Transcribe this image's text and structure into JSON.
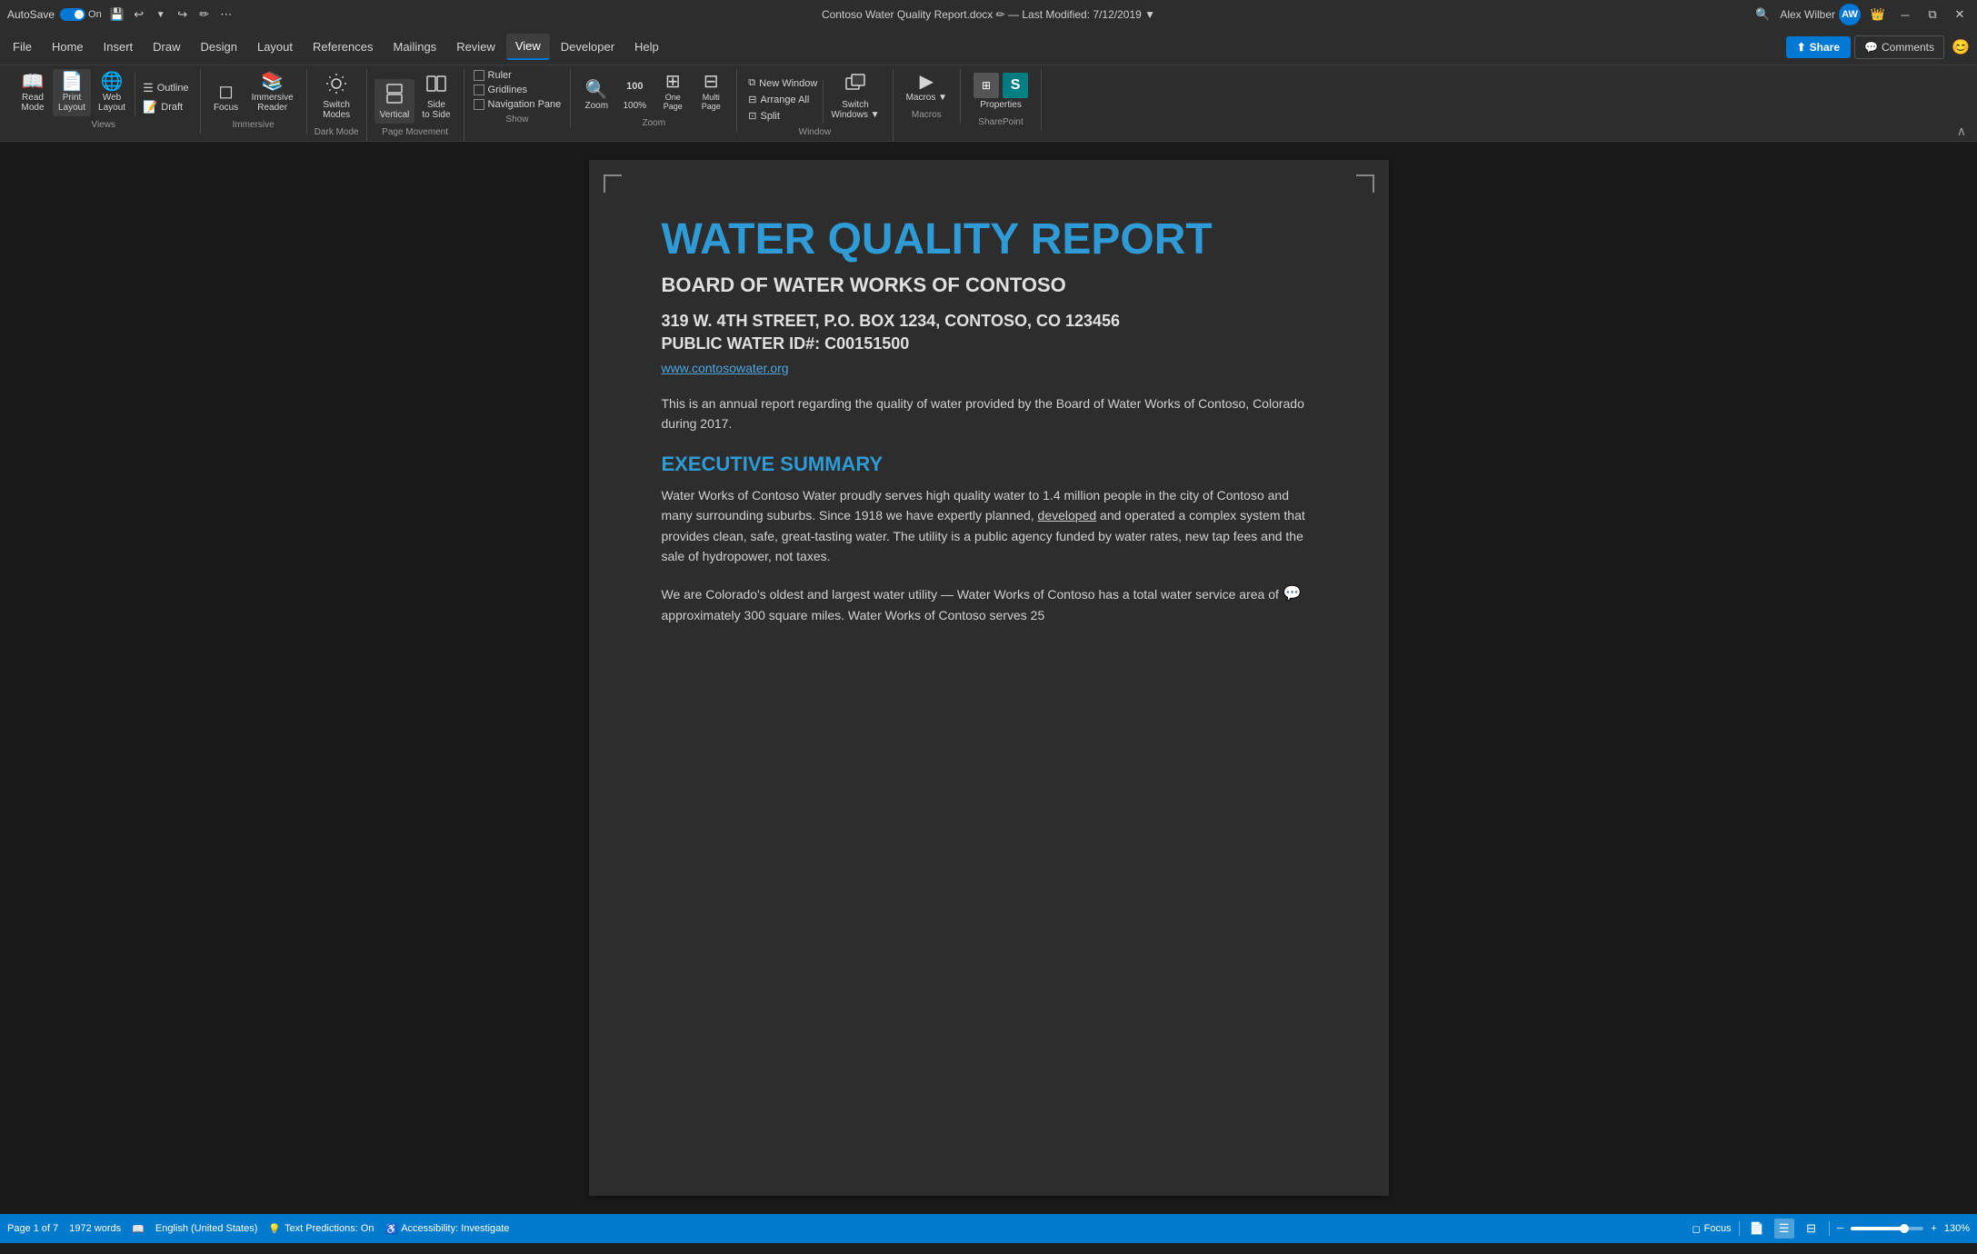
{
  "titlebar": {
    "autosave": "AutoSave",
    "on_label": "On",
    "filename": "Contoso Water Quality Report.docx",
    "separator": "—",
    "last_modified": "Last Modified: 7/12/2019",
    "user_name": "Alex Wilber",
    "user_initials": "AW"
  },
  "toolbar_icons": {
    "undo": "↩",
    "redo": "↪",
    "save": "💾",
    "more": "⋯"
  },
  "menu": {
    "items": [
      "File",
      "Home",
      "Insert",
      "Draw",
      "Design",
      "Layout",
      "References",
      "Mailings",
      "Review",
      "View",
      "Developer",
      "Help"
    ],
    "active": "View",
    "share_label": "Share",
    "comments_label": "Comments"
  },
  "ribbon": {
    "views_group": {
      "label": "Views",
      "buttons": [
        {
          "id": "read-mode",
          "icon": "📖",
          "label": "Read\nMode"
        },
        {
          "id": "print-layout",
          "icon": "📄",
          "label": "Print\nLayout",
          "active": true
        },
        {
          "id": "web-layout",
          "icon": "🌐",
          "label": "Web\nLayout"
        }
      ],
      "sub_buttons": [
        "Outline",
        "Draft"
      ]
    },
    "immersive_group": {
      "label": "Immersive",
      "buttons": [
        {
          "id": "focus",
          "icon": "◻",
          "label": "Focus"
        },
        {
          "id": "immersive-reader",
          "icon": "📚",
          "label": "Immersive\nReader"
        }
      ]
    },
    "dark_mode_group": {
      "label": "Dark Mode",
      "buttons": [
        {
          "id": "switch-modes",
          "icon": "☀",
          "label": "Switch\nModes"
        }
      ]
    },
    "page_movement_group": {
      "label": "Page Movement",
      "buttons": [
        {
          "id": "vertical",
          "icon": "⬇",
          "label": "Vertical",
          "active": true
        },
        {
          "id": "side-to-side",
          "icon": "➡",
          "label": "Side\nto Side"
        }
      ]
    },
    "show_group": {
      "label": "Show",
      "checkboxes": [
        "Ruler",
        "Gridlines",
        "Navigation Pane"
      ]
    },
    "zoom_group": {
      "label": "Zoom",
      "zoom_label": "Zoom",
      "percent_label": "100%",
      "grid_icon": "⊞"
    },
    "window_group": {
      "label": "Window",
      "buttons": [
        {
          "id": "new-window",
          "icon": "⧉",
          "label": "New Window"
        },
        {
          "id": "arrange-all",
          "icon": "⊟",
          "label": "Arrange All"
        },
        {
          "id": "split",
          "icon": "⊡",
          "label": "Split"
        },
        {
          "id": "switch-windows",
          "icon": "⧉",
          "label": "Switch\nWindows"
        }
      ]
    },
    "macros_group": {
      "label": "Macros",
      "buttons": [
        {
          "id": "macros",
          "icon": "▶",
          "label": "Macros"
        }
      ]
    },
    "sharepoint_group": {
      "label": "SharePoint",
      "buttons": [
        {
          "id": "properties",
          "icon": "S",
          "label": "Properties"
        }
      ]
    }
  },
  "document": {
    "title": "WATER QUALITY REPORT",
    "subtitle": "BOARD OF WATER WORKS OF CONTOSO",
    "address_line1": "319 W. 4TH STREET, P.O. BOX 1234, CONTOSO, CO 123456",
    "address_line2": "PUBLIC WATER ID#: C00151500",
    "website": "www.contosowater.org",
    "intro_text": "This is an annual report regarding the quality of water provided by the Board of Water Works of Contoso, Colorado during 2017.",
    "executive_summary_title": "EXECUTIVE SUMMARY",
    "executive_summary_body1": "Water Works of Contoso Water proudly serves high quality water to 1.4 million people in the city of Contoso and many surrounding suburbs. Since 1918 we have expertly planned, developed and operated a complex system that provides clean, safe, great-tasting water. The utility is a public agency funded by water rates, new tap fees and the sale of hydropower, not taxes.",
    "executive_summary_body2": "We are Colorado's oldest and largest water utility — Water Works of Contoso has a total water service area of approximately 300 square miles. Water Works of Contoso serves 25"
  },
  "statusbar": {
    "page_info": "Page 1 of 7",
    "word_count": "1972 words",
    "language": "English (United States)",
    "text_predictions": "Text Predictions: On",
    "accessibility": "Accessibility: Investigate",
    "focus_mode": "Focus",
    "zoom_percent": "130%",
    "view_modes": [
      "🔲",
      "☰",
      "⊟"
    ]
  }
}
